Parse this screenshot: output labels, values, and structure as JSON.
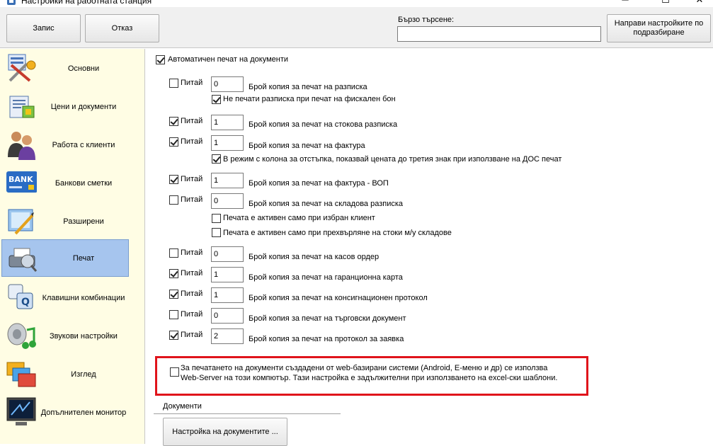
{
  "window": {
    "title": "Настройки на работната станция"
  },
  "toolbar": {
    "save_label": "Запис",
    "cancel_label": "Отказ",
    "search_label": "Бързо търсене:",
    "search_value": "",
    "defaults_label": "Направи настройките по подразбиране"
  },
  "sidebar": {
    "items": [
      {
        "label": "Основни",
        "icon": "tools-icon"
      },
      {
        "label": "Цени и документи",
        "icon": "documents-icon"
      },
      {
        "label": "Работа с клиенти",
        "icon": "clients-icon"
      },
      {
        "label": "Банкови сметки",
        "icon": "bank-card-icon",
        "icon_text": "BANK"
      },
      {
        "label": "Разширени",
        "icon": "advanced-icon"
      },
      {
        "label": "Печат",
        "icon": "printer-icon",
        "active": true
      },
      {
        "label": "Клавишни комбинации",
        "icon": "keyboard-icon",
        "icon_text": "Q"
      },
      {
        "label": "Звукови настройки",
        "icon": "sound-icon"
      },
      {
        "label": "Изглед",
        "icon": "view-icon"
      },
      {
        "label": "Допълнителен монитор",
        "icon": "monitor-icon"
      }
    ]
  },
  "print": {
    "auto_print_label": "Автоматичен печат на документи",
    "auto_print_checked": true,
    "ask_label": "Питай",
    "rows": [
      {
        "ask": false,
        "value": "0",
        "label": "Брой копия за печат на разписка"
      },
      {
        "ask": true,
        "value": "1",
        "label": "Брой копия за печат на стокова разписка"
      },
      {
        "ask": true,
        "value": "1",
        "label": "Брой копия за печат на фактура"
      },
      {
        "ask": true,
        "value": "1",
        "label": "Брой копия за печат на фактура - ВОП"
      },
      {
        "ask": false,
        "value": "0",
        "label": "Брой копия за печат на складова разписка"
      },
      {
        "ask": false,
        "value": "0",
        "label": "Брой копия за печат на касов ордер"
      },
      {
        "ask": true,
        "value": "1",
        "label": "Брой копия за печат на гаранционна карта"
      },
      {
        "ask": true,
        "value": "1",
        "label": "Брой копия за печат на консигнационен протокол"
      },
      {
        "ask": false,
        "value": "0",
        "label": "Брой копия за печат на търговски документ"
      },
      {
        "ask": true,
        "value": "2",
        "label": "Брой копия за печат на протокол за заявка"
      }
    ],
    "no_receipt_fiscal": {
      "label": "Не печати разписка при печат на фискален бон",
      "checked": true
    },
    "invoice_discount": {
      "label": "В режим с колона за отстъпка, показвай цената до третия знак при използване на ДОС печат",
      "checked": true
    },
    "active_client": {
      "label": "Печата е активен само при избран клиент",
      "checked": false
    },
    "active_transfer": {
      "label": "Печата е активен само при прехвърляне на стоки м/у складове",
      "checked": false
    },
    "webserver": {
      "line1": "За печатането на документи създадени от web-базирани системи (Android, Е-меню и др) се използва",
      "line2": "Web-Server на този компютър. Тази настройка е задължителни при използването на excel-ски шаблони.",
      "checked": false
    }
  },
  "documents": {
    "group_label": "Документи",
    "settings_button": "Настройка на документите ..."
  },
  "colors": {
    "sidebar_bg": "#fffde4",
    "active_item": "#a6c5ee",
    "highlight_border": "#e0141b"
  }
}
